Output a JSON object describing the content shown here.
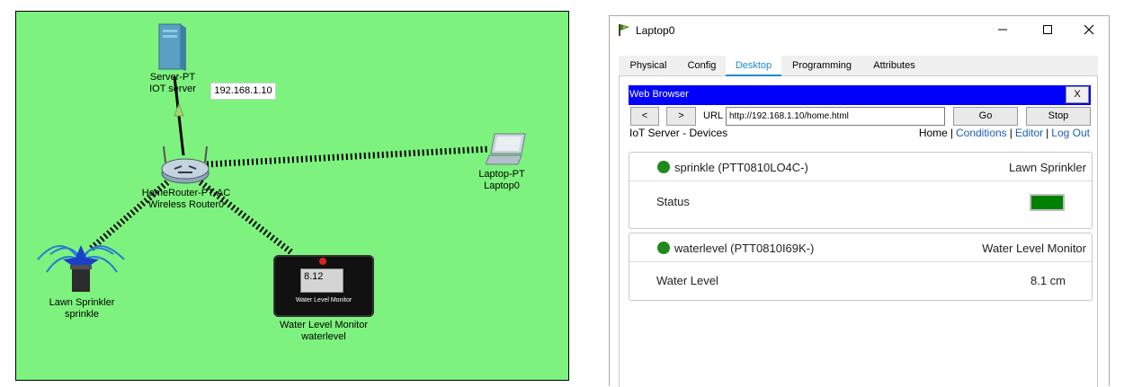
{
  "topology": {
    "devices": {
      "server": {
        "type_label": "Server-PT",
        "name": "IOT server"
      },
      "router": {
        "type_label": "HomeRouter-PT-AC",
        "name": "Wireless Router0"
      },
      "laptop": {
        "type_label": "Laptop-PT",
        "name": "Laptop0"
      },
      "sprinkler": {
        "type_label": "Lawn Sprinkler",
        "name": "sprinkle"
      },
      "water_monitor": {
        "type_label": "Water Level Monitor",
        "name": "waterlevel",
        "screen_value": "8.12",
        "screen_caption": "Water Level Monitor"
      }
    },
    "ip_label": "192.168.1.10",
    "background_color": "#7ef27e"
  },
  "window": {
    "title": "Laptop0",
    "controls": {
      "minimize": "minimize-icon",
      "maximize": "maximize-icon",
      "close": "close-icon"
    },
    "tabs": [
      {
        "label": "Physical",
        "active": false
      },
      {
        "label": "Config",
        "active": false
      },
      {
        "label": "Desktop",
        "active": true
      },
      {
        "label": "Programming",
        "active": false
      },
      {
        "label": "Attributes",
        "active": false
      }
    ]
  },
  "browser": {
    "title": "Web Browser",
    "close_label": "X",
    "back_label": "<",
    "forward_label": ">",
    "url_label": "URL",
    "url": "http://192.168.1.10/home.html",
    "go_label": "Go",
    "stop_label": "Stop"
  },
  "page": {
    "heading": "IoT Server - Devices",
    "nav": {
      "home": "Home",
      "conditions": "Conditions",
      "editor": "Editor",
      "logout": "Log Out",
      "separator": "|"
    },
    "devices": [
      {
        "name": "sprinkle (PTT0810LO4C-)",
        "type": "Lawn Sprinkler",
        "property": "Status",
        "value": "",
        "status_color": "#008000",
        "online_color": "#1e8a1e"
      },
      {
        "name": "waterlevel (PTT0810I69K-)",
        "type": "Water Level Monitor",
        "property": "Water Level",
        "value": "8.1 cm",
        "online_color": "#1e8a1e"
      }
    ]
  }
}
